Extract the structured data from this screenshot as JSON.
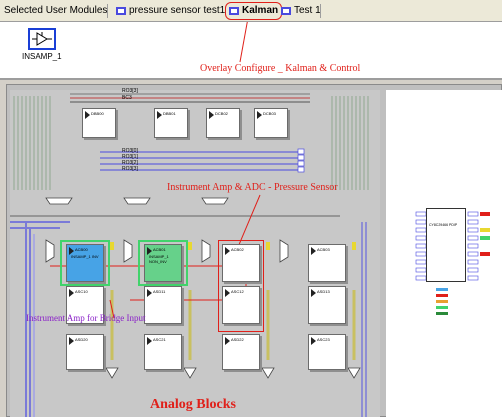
{
  "tabs": {
    "selected_user_modules": "Selected User Modules",
    "pressure": "pressure sensor test1",
    "kalman": "Kalman",
    "test1": "Test 1"
  },
  "module_panel": {
    "module_label": "INSAMP_1"
  },
  "annotations": {
    "overlay": "Overlay Configure _ Kalman & Control",
    "instrument_adc": "Instrument Amp & ADC - Pressure Sensor",
    "bridge": "Instrument Amp for Bridge Input",
    "analog_blocks": "Analog Blocks"
  },
  "buses": [
    "RO3[3]",
    "BC3",
    "RO3[0]",
    "RO3[1]",
    "RO3[2]",
    "RO3[3]"
  ],
  "digital_blocks": [
    "DBB00",
    "DBB01",
    "DCB02",
    "DCB03"
  ],
  "analog_blocks": {
    "row0": [
      "ACB00",
      "ACB01",
      "ACB02",
      "ACB03"
    ],
    "row1": [
      "ASC10",
      "ASD11",
      "ASC12",
      "ASD13"
    ],
    "row2": [
      "ASD20",
      "ASC21",
      "ASD22",
      "ASC23"
    ]
  },
  "placed": [
    {
      "name": "INSAMP_1 INV",
      "block": "ACB00"
    },
    {
      "name": "INSAMP_1 NON_INV",
      "block": "ACB01"
    }
  ],
  "chip": {
    "label": "CY8C29466 PDIP"
  },
  "colors": {
    "annotation_red": "#e0201a",
    "annotation_purple": "#8a20c8",
    "placed_blue": "#47a3e6",
    "placed_green": "#66d18a",
    "highlight_green": "#41d36b",
    "bus_blue": "#4a4adf"
  }
}
